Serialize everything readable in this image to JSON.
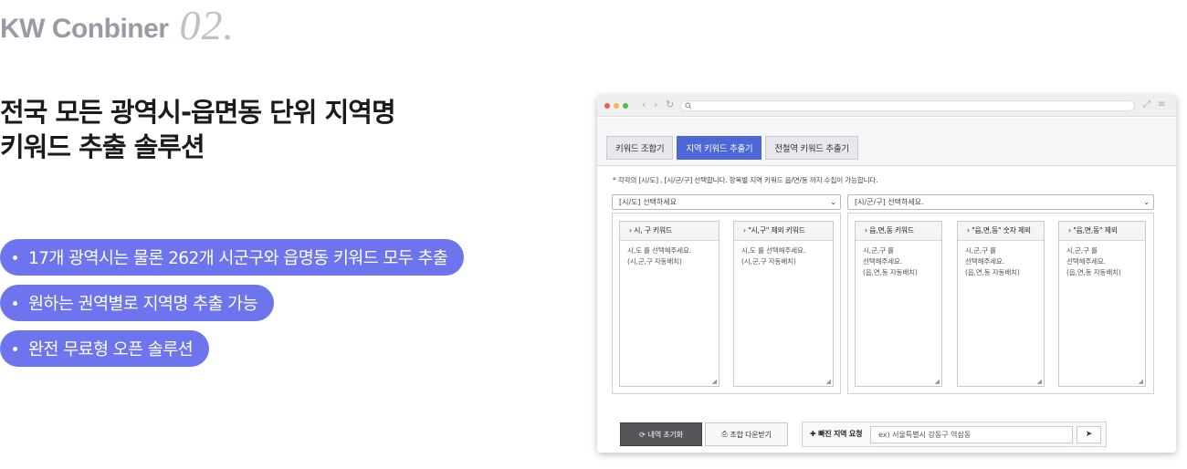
{
  "brand": {
    "name": "KW Conbiner",
    "number": "02."
  },
  "headline": {
    "line1": "전국 모든 광역시-읍면동 단위 지역명",
    "line2": "키워드 추출 솔루션"
  },
  "features": [
    "17개 광역시는 물론 262개 시군구와 읍명동 키워드 모두 추출",
    "원하는 권역별로 지역명 추출 가능",
    "완전 무료형 오픈 솔루션"
  ],
  "colors": {
    "pill": "#6d74ee",
    "active_tab": "#4d67d6",
    "dark_button": "#555659"
  },
  "browser": {
    "nav_back": "‹",
    "nav_forward": "›",
    "nav_reload": "↻",
    "search_icon": "search-icon",
    "tabs": [
      {
        "label": "키워드 조합기",
        "active": false
      },
      {
        "label": "지역 키워드 추출기",
        "active": true
      },
      {
        "label": "전철역 키워드 추출기",
        "active": false
      }
    ],
    "note": "* 각각의 [시/도] , [시/군/구] 선택합니다. 항목별 지역 키워드 읍/면/동 까지 수집이 가능합니다.",
    "select_sido": "[시/도] 선택하세요",
    "select_sigungu": "[시/군/구] 선택하세요.",
    "left_boxes": [
      {
        "header": "› 시, 구 키워드",
        "body": "시,도 를 선택해주세요.\n(시,군,구 자동배치)"
      },
      {
        "header": "› \"시,구\" 제외 키워드",
        "body": "시,도 를 선택해주세요.\n(시,군,구 자동배치)"
      }
    ],
    "right_boxes": [
      {
        "header": "› 읍,면,동 키워드",
        "body": "시,군,구 를\n선택해주세요.\n(읍,면,동 자동배치)"
      },
      {
        "header": "› \"읍,면,동\" 숫자 제외",
        "body": "시,군,구 를\n선택해주세요.\n(읍,면,동 자동배치)"
      },
      {
        "header": "› \"읍,면,동\" 제외",
        "body": "시,군,구 를\n선택해주세요.\n(읍,면,동 자동배치)"
      }
    ],
    "reset_button": "내역 초기화",
    "download_button": "조합 다운받기",
    "missing_label": "빠진 지역 요청",
    "missing_placeholder": "ex) 서울특별시 강동구 역삼동",
    "send_icon": "paper-plane-icon"
  }
}
